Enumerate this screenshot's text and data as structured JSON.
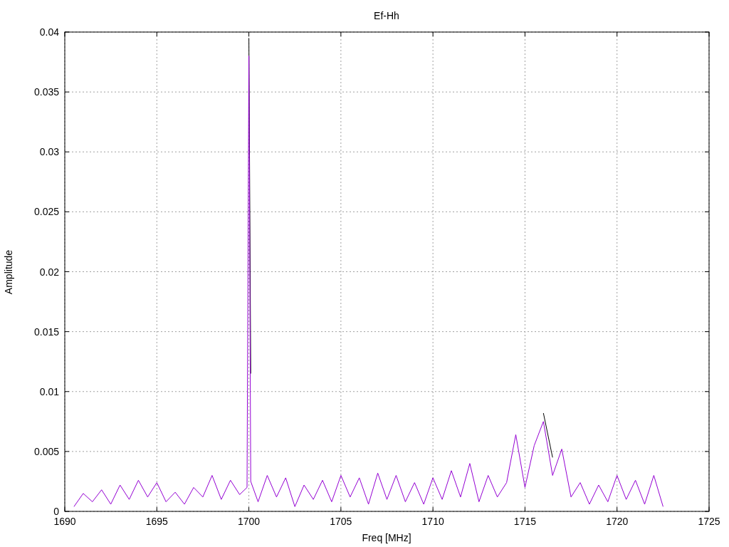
{
  "chart_data": {
    "type": "line",
    "grid": true,
    "title": "Ef-Hh",
    "xlabel": "Freq [MHz]",
    "ylabel": "Amplitude",
    "xlim": [
      1690,
      1725
    ],
    "ylim": [
      0,
      0.04
    ],
    "xticks": [
      1690,
      1695,
      1700,
      1705,
      1710,
      1715,
      1720,
      1725
    ],
    "yticks": [
      {
        "value": 0,
        "label": "0"
      },
      {
        "value": 0.005,
        "label": "0.005"
      },
      {
        "value": 0.01,
        "label": "0.01"
      },
      {
        "value": 0.015,
        "label": "0.015"
      },
      {
        "value": 0.02,
        "label": "0.02"
      },
      {
        "value": 0.025,
        "label": "0.025"
      },
      {
        "value": 0.03,
        "label": "0.03"
      },
      {
        "value": 0.035,
        "label": "0.035"
      },
      {
        "value": 0.04,
        "label": "0.04"
      }
    ],
    "x": [
      1690.5,
      1691,
      1691.5,
      1692,
      1692.5,
      1693,
      1693.5,
      1694,
      1694.5,
      1695,
      1695.5,
      1696,
      1696.5,
      1697,
      1697.5,
      1698,
      1698.5,
      1699,
      1699.5,
      1699.9,
      1700,
      1700.1,
      1700.5,
      1701,
      1701.5,
      1702,
      1702.5,
      1703,
      1703.5,
      1704,
      1704.5,
      1705,
      1705.5,
      1706,
      1706.5,
      1707,
      1707.5,
      1708,
      1708.5,
      1709,
      1709.5,
      1710,
      1710.5,
      1711,
      1711.5,
      1712,
      1712.5,
      1713,
      1713.5,
      1714,
      1714.5,
      1715,
      1715.5,
      1716,
      1716.5,
      1717,
      1717.5,
      1718,
      1718.5,
      1719,
      1719.5,
      1720,
      1720.5,
      1721,
      1721.5,
      1722,
      1722.5
    ],
    "series": [
      {
        "color": "#000000",
        "values": [
          null,
          null,
          null,
          null,
          null,
          null,
          null,
          null,
          null,
          null,
          null,
          null,
          null,
          null,
          null,
          null,
          null,
          null,
          null,
          null,
          0.0395,
          0.0115,
          null,
          null,
          null,
          null,
          null,
          null,
          null,
          null,
          null,
          null,
          null,
          null,
          null,
          null,
          null,
          null,
          null,
          null,
          null,
          null,
          null,
          null,
          null,
          null,
          null,
          null,
          null,
          null,
          null,
          null,
          null,
          0.0082,
          0.0045,
          null,
          null,
          null,
          null,
          null,
          null,
          null,
          null,
          null,
          null,
          null,
          null
        ]
      },
      {
        "color": "#9400d3",
        "values": [
          0.0004,
          0.0015,
          0.0008,
          0.0018,
          0.0006,
          0.0022,
          0.001,
          0.0026,
          0.0012,
          0.0024,
          0.0008,
          0.0016,
          0.0006,
          0.002,
          0.0012,
          0.003,
          0.001,
          0.0026,
          0.0014,
          0.002,
          0.038,
          0.0025,
          0.0008,
          0.003,
          0.0012,
          0.0028,
          0.0004,
          0.0022,
          0.001,
          0.0026,
          0.0008,
          0.003,
          0.0012,
          0.0028,
          0.0006,
          0.0032,
          0.001,
          0.003,
          0.0008,
          0.0024,
          0.0006,
          0.0028,
          0.001,
          0.0034,
          0.0012,
          0.004,
          0.0008,
          0.003,
          0.0012,
          0.0024,
          0.0064,
          0.002,
          0.0055,
          0.0075,
          0.003,
          0.0052,
          0.0012,
          0.0024,
          0.0006,
          0.0022,
          0.0008,
          0.003,
          0.001,
          0.0026,
          0.0006,
          0.003,
          0.0004
        ]
      }
    ]
  }
}
